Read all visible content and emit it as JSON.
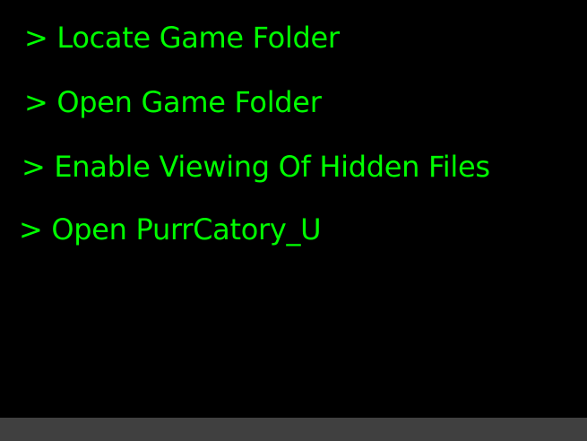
{
  "commands": [
    {
      "text": "> Locate Game Folder"
    },
    {
      "text": "> Open Game Folder"
    },
    {
      "text": "> Enable Viewing Of Hidden Files"
    },
    {
      "text": "> Open PurrCatory_U"
    }
  ],
  "colors": {
    "background": "#000000",
    "text": "#00FF00",
    "status_bar": "#404040"
  }
}
